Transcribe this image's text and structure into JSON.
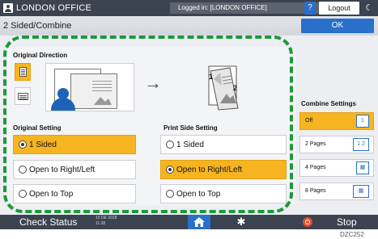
{
  "topbar": {
    "user_name": "LONDON OFFICE",
    "login_status": "Logged in: [LONDON OFFICE]",
    "help_label": "?",
    "logout_label": "Logout",
    "moon_label": "☾"
  },
  "header": {
    "title": "2 Sided/Combine",
    "ok_label": "OK"
  },
  "original_direction": {
    "title": "Original Direction",
    "options": [
      {
        "icon": "portrait-page-icon",
        "selected": true
      },
      {
        "icon": "landscape-page-icon",
        "selected": false
      }
    ]
  },
  "original_setting": {
    "title": "Original Setting",
    "options": [
      {
        "label": "1 Sided",
        "selected": true
      },
      {
        "label": "Open to Right/Left",
        "selected": false
      },
      {
        "label": "Open to Top",
        "selected": false
      }
    ]
  },
  "print_side_setting": {
    "title": "Print Side Setting",
    "options": [
      {
        "label": "1 Sided",
        "selected": false
      },
      {
        "label": "Open to Right/Left",
        "selected": true
      },
      {
        "label": "Open to Top",
        "selected": false
      }
    ]
  },
  "combine_settings": {
    "title": "Combine Settings",
    "options": [
      {
        "label": "Off",
        "selected": true
      },
      {
        "label": "2 Pages",
        "selected": false
      },
      {
        "label": "4 Pages",
        "selected": false
      },
      {
        "label": "8 Pages",
        "selected": false
      }
    ]
  },
  "print_illustration": {
    "page_1": "1",
    "page_2": "2"
  },
  "bottombar": {
    "check_status_label": "Check Status",
    "date": "10 DE 2018",
    "time": "11:38",
    "stop_label": "Stop"
  },
  "figure_code": "DZC252",
  "colors": {
    "accent_blue": "#2a6fc9",
    "selected_orange": "#f6b520",
    "callout_green": "#1a9a3a",
    "bar_dark": "#3b4250"
  }
}
